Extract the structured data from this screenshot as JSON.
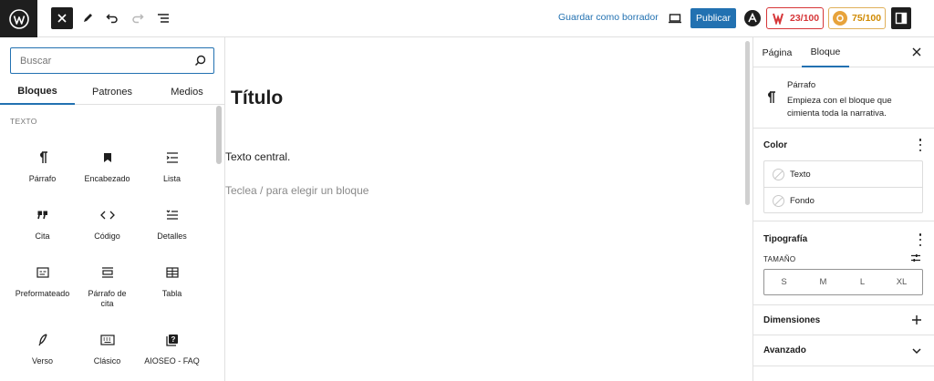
{
  "toolbar": {
    "save_draft_label": "Guardar como borrador",
    "publish_label": "Publicar",
    "seo_score": "23/100",
    "truseo_score": "75/100",
    "colors": {
      "accent": "#2271b1",
      "seo_bad": "#d63638",
      "truseo": "#d08a00",
      "dark": "#1e1e1e"
    }
  },
  "inserter": {
    "search_placeholder": "Buscar",
    "tabs": [
      {
        "label": "Bloques",
        "active": true
      },
      {
        "label": "Patrones",
        "active": false
      },
      {
        "label": "Medios",
        "active": false
      }
    ],
    "category": "TEXTO",
    "blocks": [
      {
        "label": "Párrafo",
        "icon": "paragraph-icon"
      },
      {
        "label": "Encabezado",
        "icon": "heading-bookmark-icon"
      },
      {
        "label": "Lista",
        "icon": "list-icon"
      },
      {
        "label": "Cita",
        "icon": "quote-icon"
      },
      {
        "label": "Código",
        "icon": "code-icon"
      },
      {
        "label": "Detalles",
        "icon": "details-icon"
      },
      {
        "label": "Preformateado",
        "icon": "preformatted-icon"
      },
      {
        "label": "Párrafo de cita",
        "icon": "pullquote-icon"
      },
      {
        "label": "Tabla",
        "icon": "table-icon"
      },
      {
        "label": "Verso",
        "icon": "verse-icon"
      },
      {
        "label": "Clásico",
        "icon": "keyboard-icon"
      },
      {
        "label": "AIOSEO - FAQ",
        "icon": "faq-icon"
      }
    ]
  },
  "editor": {
    "title": "Título",
    "paragraph": "Texto central.",
    "placeholder": "Teclea / para elegir un bloque"
  },
  "settings": {
    "tabs": [
      {
        "label": "Página",
        "active": false
      },
      {
        "label": "Bloque",
        "active": true
      }
    ],
    "block_card": {
      "title": "Párrafo",
      "description": "Empieza con el bloque que cimienta toda la narrativa."
    },
    "color": {
      "title": "Color",
      "items": [
        "Texto",
        "Fondo"
      ]
    },
    "typography": {
      "title": "Tipografía",
      "size_label": "TAMAÑO",
      "sizes": [
        "S",
        "M",
        "L",
        "XL"
      ]
    },
    "dimensions_title": "Dimensiones",
    "advanced_title": "Avanzado"
  }
}
